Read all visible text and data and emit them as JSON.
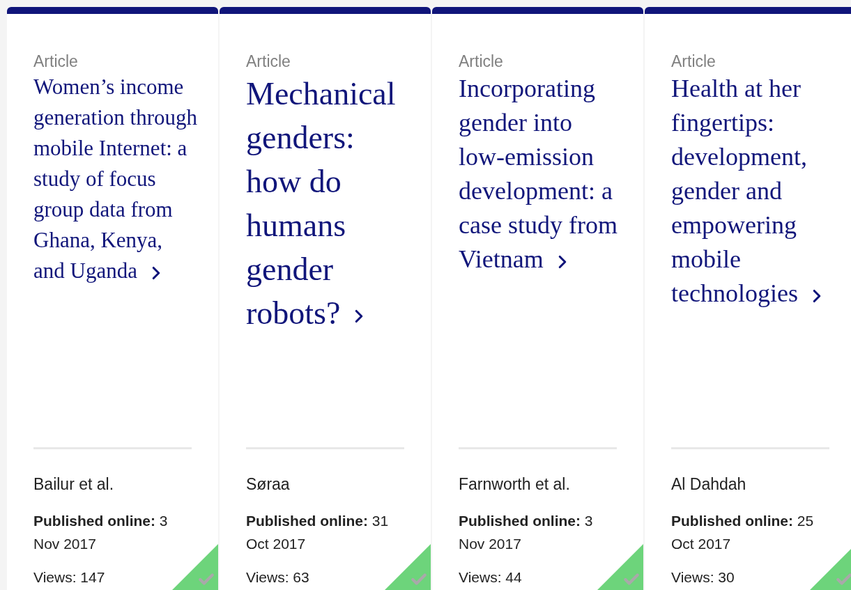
{
  "cards": [
    {
      "type": "Article",
      "title": "Women’s income generation through mobile Internet: a study of focus group data from Ghana, Kenya, and Uganda",
      "authors": "Bailur et al.",
      "published_label": "Published online:",
      "published_date": "3 Nov 2017",
      "views": "Views: 147",
      "open_access": true
    },
    {
      "type": "Article",
      "title": "Mechanical genders: how do humans gender robots?",
      "authors": "Søraa",
      "published_label": "Published online:",
      "published_date": "31 Oct 2017",
      "views": "Views: 63",
      "open_access": true
    },
    {
      "type": "Article",
      "title": "Incorporating gender into low-emission development: a case study from Vietnam",
      "authors": "Farnworth et al.",
      "published_label": "Published online:",
      "published_date": "3 Nov 2017",
      "views": "Views: 44",
      "open_access": true
    },
    {
      "type": "Article",
      "title": "Health at her fingertips: development, gender and empowering mobile technologies",
      "authors": "Al Dahdah",
      "published_label": "Published online:",
      "published_date": "25 Oct 2017",
      "views": "Views: 30",
      "open_access": true
    }
  ]
}
